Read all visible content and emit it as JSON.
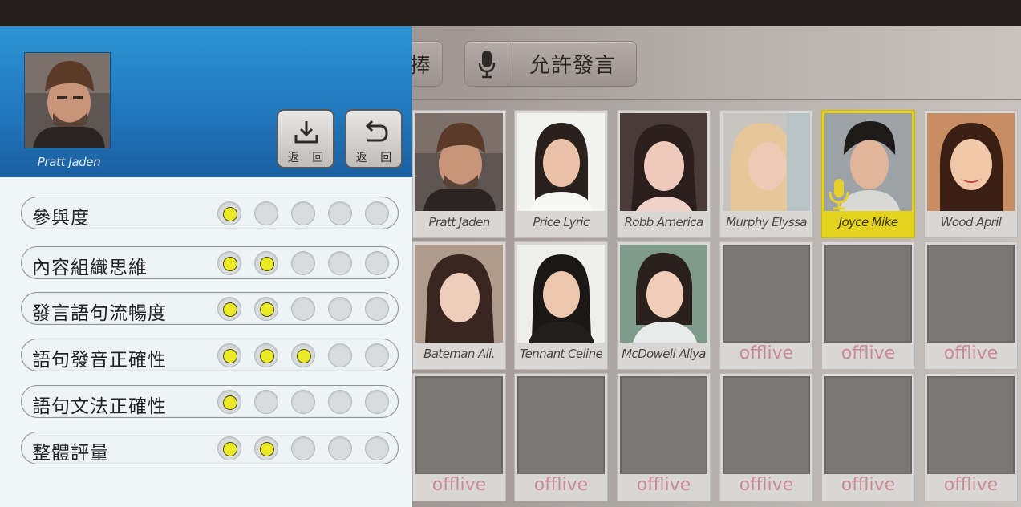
{
  "toolbar": {
    "partial_label": "捧",
    "speak_label": "允許發言"
  },
  "panel": {
    "selected_name": "Pratt Jaden",
    "save_button_label": "返 回",
    "back_button_label": "返 回",
    "ratings": [
      {
        "label": "參與度",
        "level": 1,
        "max": 5
      },
      {
        "label": "內容組織思維",
        "level": 2,
        "max": 5
      },
      {
        "label": "發言語句流暢度",
        "level": 2,
        "max": 5
      },
      {
        "label": "語句發音正確性",
        "level": 3,
        "max": 5
      },
      {
        "label": "語句文法正確性",
        "level": 1,
        "max": 5
      },
      {
        "label": "整體評量",
        "level": 2,
        "max": 5
      }
    ]
  },
  "students": [
    {
      "name": "Pratt Jaden",
      "status": "online"
    },
    {
      "name": "Price Lyric",
      "status": "online"
    },
    {
      "name": "Robb America",
      "status": "online"
    },
    {
      "name": "Murphy Elyssa",
      "status": "online"
    },
    {
      "name": "Joyce Mike",
      "status": "speaking"
    },
    {
      "name": "Wood April",
      "status": "online"
    },
    {
      "name": "Bateman Ali.",
      "status": "online"
    },
    {
      "name": "Tennant Celine",
      "status": "online"
    },
    {
      "name": "McDowell  Aliya",
      "status": "online"
    },
    {
      "name": "offlive",
      "status": "offline"
    },
    {
      "name": "offlive",
      "status": "offline"
    },
    {
      "name": "offlive",
      "status": "offline"
    },
    {
      "name": "offlive",
      "status": "offline"
    },
    {
      "name": "offlive",
      "status": "offline"
    },
    {
      "name": "offlive",
      "status": "offline"
    },
    {
      "name": "offlive",
      "status": "offline"
    },
    {
      "name": "offlive",
      "status": "offline"
    },
    {
      "name": "offlive",
      "status": "offline"
    }
  ],
  "colors": {
    "panel_header": "#2179bd",
    "active_tile": "#e3d21e",
    "rating_dot_on": "#ecea27",
    "offline_text": "#c98a94"
  },
  "icons": {
    "save": "download-icon",
    "back": "undo-icon",
    "speak": "microphone-icon"
  }
}
